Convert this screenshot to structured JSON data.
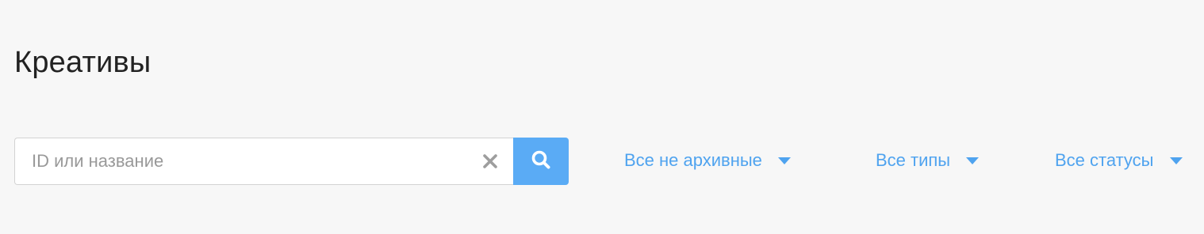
{
  "page": {
    "title": "Креативы"
  },
  "search": {
    "placeholder": "ID или название",
    "value": ""
  },
  "filters": {
    "archive": "Все не архивные",
    "types": "Все типы",
    "statuses": "Все статусы"
  },
  "colors": {
    "background": "#f7f7f7",
    "accent": "#5aabf5",
    "link": "#4fa3ef",
    "title_text": "#222222",
    "placeholder_text": "#999999",
    "clear_icon": "#9e9e9e"
  },
  "icons": {
    "clear": "close-icon",
    "search": "search-icon",
    "dropdown": "caret-down-icon"
  }
}
